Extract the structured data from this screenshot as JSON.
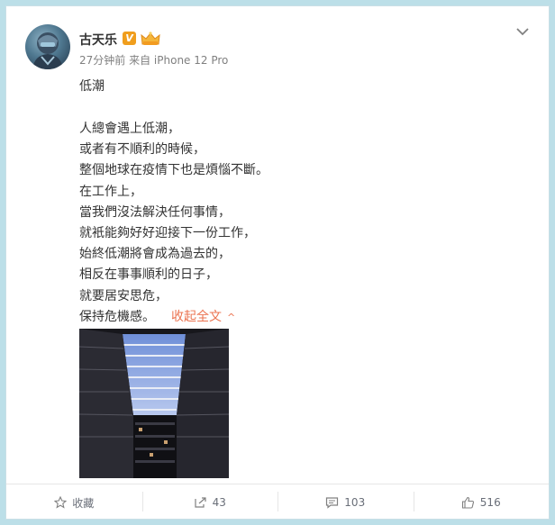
{
  "post": {
    "username": "古天乐",
    "verified_badge": "V",
    "meta_time": "27分钟前",
    "meta_source": "来自 iPhone 12 Pro",
    "title": "低潮",
    "lines": [
      "人總會遇上低潮，",
      "或者有不順利的時候，",
      "整個地球在疫情下也是煩惱不斷。",
      "在工作上，",
      "當我們沒法解決任何事情，",
      "就衹能夠好好迎接下一份工作，",
      "始終低潮將會成為過去的，",
      "相反在事事順利的日子，",
      "就要居安思危，",
      "保持危機感。"
    ],
    "collapse_label": "收起全文",
    "collapse_arrow": "^"
  },
  "actions": {
    "favorite_label": "收藏",
    "repost_count": "43",
    "comment_count": "103",
    "like_count": "516"
  },
  "icons": {
    "menu": "chevron-down-icon",
    "favorite": "star-icon",
    "repost": "repost-icon",
    "comment": "comment-icon",
    "like": "thumbs-up-icon"
  },
  "colors": {
    "background": "#bcdfe8",
    "link": "#eb7350",
    "vip_badge": "#f09e1d"
  }
}
